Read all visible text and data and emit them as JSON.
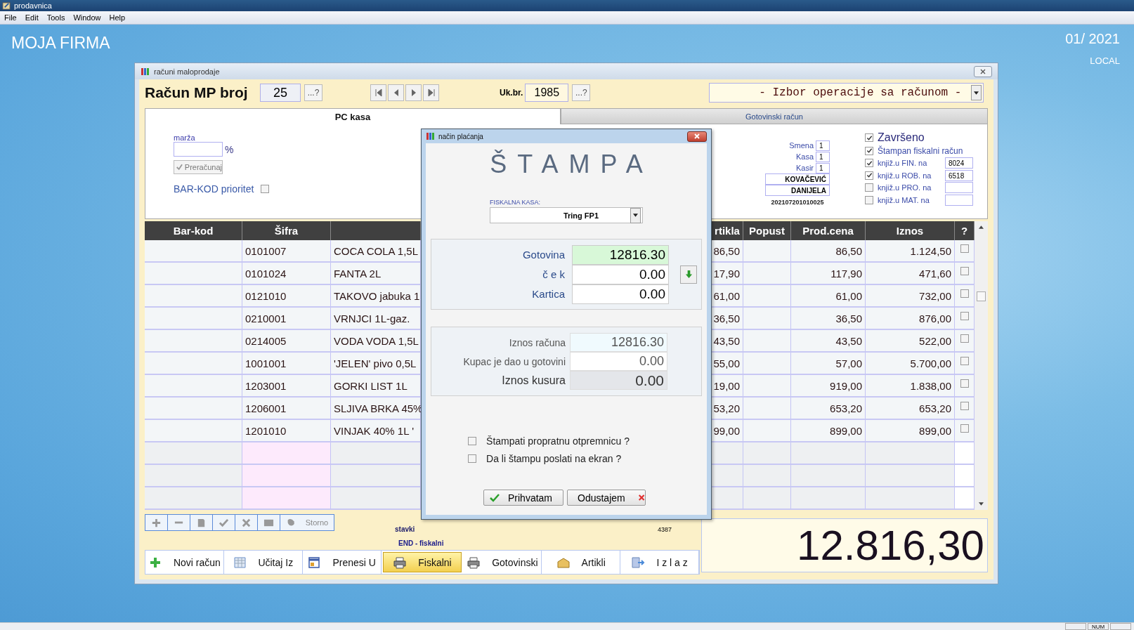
{
  "app_window": {
    "title": "prodavnica"
  },
  "menu": [
    "File",
    "Edit",
    "Tools",
    "Window",
    "Help"
  ],
  "company": "MOJA FIRMA",
  "period": "01/ 2021",
  "location": "LOCAL",
  "form": {
    "title": "računi maloprodaje",
    "invoice_label": "Račun MP broj",
    "invoice_number": "25",
    "lookup_button": "...?",
    "count_label": "Uk.br.",
    "count_number": "1985",
    "count_lookup_button": "...?",
    "operation_select": "- Izbor operacije sa računom -",
    "tabs": [
      {
        "label": "PC kasa",
        "selected": true
      },
      {
        "label": "Gotovinski račun",
        "selected": false
      }
    ],
    "margin_label": "marža",
    "margin_unit": "%",
    "recalc_button": "Preračunaj",
    "barcode_priority": {
      "label": "BAR-KOD prioritet",
      "checked": false
    },
    "info_fields": [
      {
        "label": "Smena",
        "value": "1"
      },
      {
        "label": "Kasa",
        "value": "1"
      },
      {
        "label": "Kasir",
        "value": "1"
      }
    ],
    "cashier_surname": "KOVAČEVIĆ",
    "cashier_name": "DANIJELA",
    "document_code": "202107201010025",
    "status_checks": [
      {
        "kind": "large",
        "label": "Završeno",
        "checked": true
      },
      {
        "kind": "plain",
        "label": "Štampan fiskalni račun",
        "checked": true
      },
      {
        "kind": "booking",
        "label": "knjiž.u FIN. na",
        "checked": true,
        "value": "8024"
      },
      {
        "kind": "booking",
        "label": "knjiž.u ROB. na",
        "checked": true,
        "value": "6518"
      },
      {
        "kind": "booking",
        "label": "knjiž.u PRO. na",
        "checked": false
      },
      {
        "kind": "booking",
        "label": "knjiž.u MAT. na",
        "checked": false
      }
    ]
  },
  "table": {
    "columns_left": [
      "Bar-kod",
      "Šifra"
    ],
    "columns_right": [
      "rtikla",
      "Popust",
      "Prod.cena",
      "Iznos",
      "?"
    ],
    "rows": [
      {
        "kind": "item",
        "sifra": "0101007",
        "naziv": "COCA COLA 1,5L",
        "column_3": "86,50",
        "prod_cena": "86,50",
        "iznos": "1.124,50",
        "checked": false
      },
      {
        "kind": "item",
        "sifra": "0101024",
        "naziv": "FANTA 2L",
        "column_3": "17,90",
        "prod_cena": "117,90",
        "iznos": "471,60",
        "checked": false
      },
      {
        "kind": "item",
        "sifra": "0121010",
        "naziv": "TAKOVO jabuka 1",
        "column_3": "61,00",
        "prod_cena": "61,00",
        "iznos": "732,00",
        "checked": false
      },
      {
        "kind": "item",
        "sifra": "0210001",
        "naziv": "VRNJCI 1L-gaz.",
        "column_3": "36,50",
        "prod_cena": "36,50",
        "iznos": "876,00",
        "checked": false
      },
      {
        "kind": "item",
        "sifra": "0214005",
        "naziv": "VODA VODA 1,5L",
        "column_3": "43,50",
        "prod_cena": "43,50",
        "iznos": "522,00",
        "checked": false
      },
      {
        "kind": "item",
        "sifra": "1001001",
        "naziv": "'JELEN' pivo 0,5L",
        "column_3": "55,00",
        "prod_cena": "57,00",
        "iznos": "5.700,00",
        "checked": false
      },
      {
        "kind": "item",
        "sifra": "1203001",
        "naziv": "GORKI LIST 1L",
        "column_3": "19,00",
        "prod_cena": "919,00",
        "iznos": "1.838,00",
        "checked": false
      },
      {
        "kind": "item",
        "sifra": "1206001",
        "naziv": "SLJIVA BRKA 45%",
        "column_3": "53,20",
        "prod_cena": "653,20",
        "iznos": "653,20",
        "checked": false
      },
      {
        "kind": "item",
        "sifra": "1201010",
        "naziv": "VINJAK 40% 1L '",
        "column_3": "99,00",
        "prod_cena": "899,00",
        "iznos": "899,00",
        "checked": false
      },
      {
        "kind": "empty"
      },
      {
        "kind": "empty"
      },
      {
        "kind": "empty"
      }
    ]
  },
  "footer": {
    "storno_button": "Storno",
    "items_label": "stavki",
    "counter": "4387",
    "fiscal_status": "END - fiskalni",
    "actions": [
      {
        "label": "Novi račun",
        "selected": false
      },
      {
        "label": "Učitaj Iz",
        "selected": false
      },
      {
        "label": "Prenesi U",
        "selected": false
      },
      {
        "label": "Fiskalni",
        "selected": true
      },
      {
        "label": "Gotovinski",
        "selected": false
      },
      {
        "label": "Artikli",
        "selected": false
      },
      {
        "label": "I z l a z",
        "selected": false
      }
    ],
    "grand_total": "12.816,30"
  },
  "dialog": {
    "title": "način plaćanja",
    "heading": "ŠTAMPA",
    "fiscal_label": "FISKALNA KASA:",
    "fiscal_device": "Tring FP1",
    "payments": [
      {
        "label": "Gotovina",
        "value": "12816.30",
        "selected": true
      },
      {
        "label": "č e k",
        "value": "0.00",
        "selected": false
      },
      {
        "label": "Kartica",
        "value": "0.00",
        "selected": false
      }
    ],
    "summary": [
      {
        "kind": "readonly",
        "label": "Iznos računa",
        "value": "12816.30"
      },
      {
        "kind": "input",
        "label": "Kupac je dao u gotovini",
        "value": "0.00"
      },
      {
        "kind": "result",
        "label": "Iznos kusura",
        "value": "0.00"
      }
    ],
    "options": [
      {
        "label": "Štampati propratnu otpremnicu ?",
        "checked": false
      },
      {
        "label": "Da li štampu poslati na ekran ?",
        "checked": false
      }
    ],
    "buttons": [
      {
        "kind": "accept",
        "label": "Prihvatam"
      },
      {
        "kind": "cancel",
        "label": "Odustajem"
      }
    ]
  },
  "status_bar": {
    "indicator": "NUM"
  }
}
